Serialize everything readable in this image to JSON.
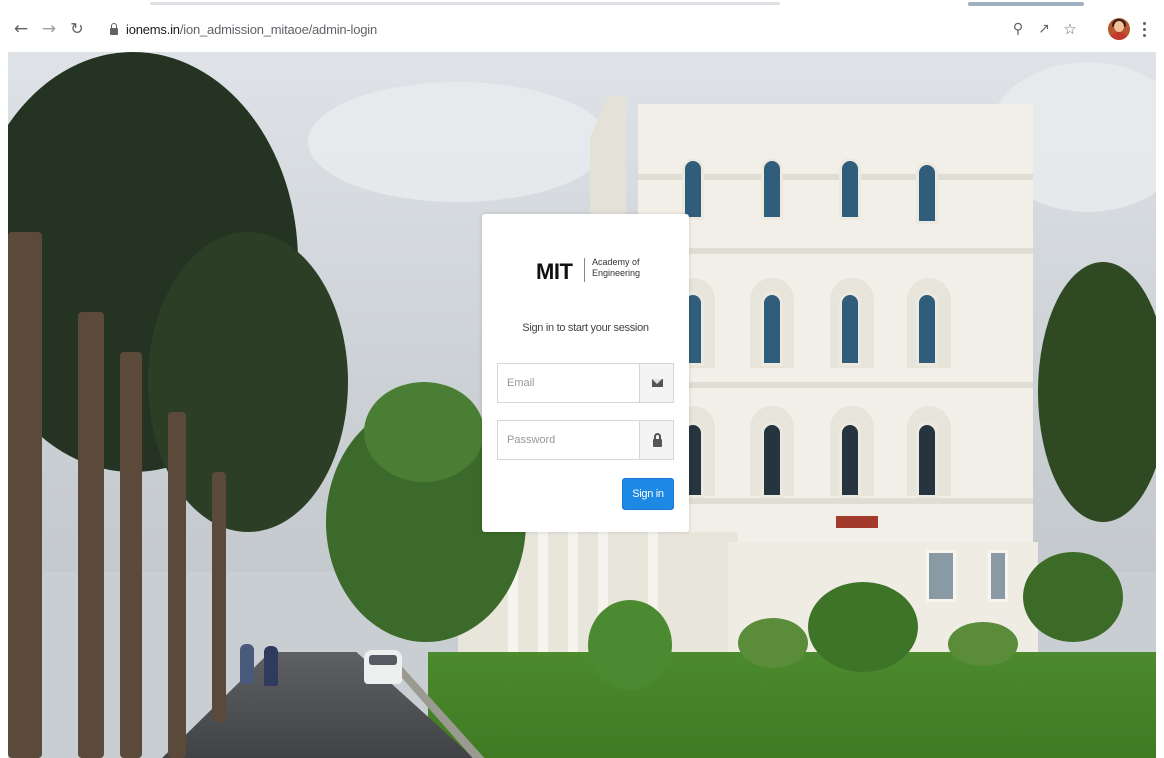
{
  "browser": {
    "url_host": "ionems.in",
    "url_path": "/ion_admission_mitaoe/admin-login",
    "back_icon": "back-arrow-icon",
    "forward_icon": "forward-arrow-icon",
    "reload_icon": "reload-icon",
    "zoom_icon": "zoom-icon",
    "share_icon": "share-icon",
    "bookmark_icon": "star-icon",
    "menu_icon": "kebab-menu-icon"
  },
  "login": {
    "logo_text": "MIT",
    "logo_subtext_line1": "Academy of",
    "logo_subtext_line2": "Engineering",
    "subtitle": "Sign in to start your session",
    "email_placeholder": "Email",
    "password_placeholder": "Password",
    "signin_label": "Sign in",
    "email_icon": "envelope-icon",
    "password_icon": "lock-icon",
    "button_color": "#1e88e5"
  }
}
